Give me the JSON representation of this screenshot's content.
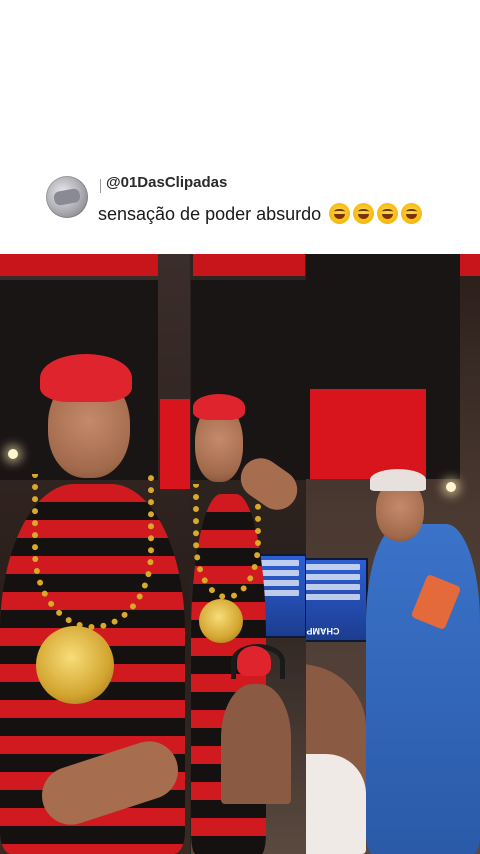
{
  "post": {
    "username": "@01DasClipadas",
    "caption": "sensação de poder absurdo",
    "caption_emojis": [
      "rolling-on-floor-laughing",
      "rolling-on-floor-laughing",
      "rolling-on-floor-laughing",
      "rolling-on-floor-laughing"
    ]
  },
  "video": {
    "screen_text": "CHAMPIONS"
  },
  "colors": {
    "accent_red": "#c8151b",
    "text": "#1a1a1a",
    "background": "#ffffff"
  }
}
